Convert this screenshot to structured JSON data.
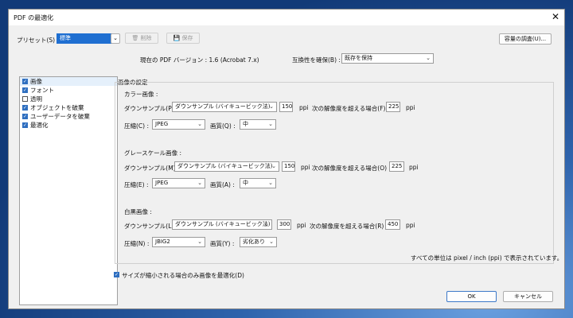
{
  "dialog": {
    "title": "PDF の最適化",
    "close_glyph": "✕"
  },
  "toolbar": {
    "preset_label": "プリセット(S) :",
    "preset_value": "標準",
    "delete_label": "削除",
    "save_label": "保存",
    "audit_label": "容量の調査(U)..."
  },
  "version": {
    "current": "現在の PDF バージョン : 1.6 (Acrobat 7.x)",
    "compat_label": "互換性を確保(B) :",
    "compat_value": "既存を保持"
  },
  "sidebar": {
    "items": [
      {
        "label": "画像",
        "checked": true
      },
      {
        "label": "フォント",
        "checked": true
      },
      {
        "label": "透明",
        "checked": false
      },
      {
        "label": "オブジェクトを破棄",
        "checked": true
      },
      {
        "label": "ユーザーデータを破棄",
        "checked": true
      },
      {
        "label": "最適化",
        "checked": true
      }
    ]
  },
  "settings": {
    "group_title": "画像の設定",
    "color": {
      "title": "カラー画像 :",
      "downsample_label": "ダウンサンプル(P) :",
      "downsample_value": "ダウンサンプル (バイキュービック法)",
      "ppi_value": "150",
      "ppi_unit": "ppi",
      "above_label": "次の解像度を超える場合(F) :",
      "above_value": "225",
      "above_unit": "ppi",
      "compress_label": "圧縮(C) :",
      "compress_value": "JPEG",
      "quality_label": "画質(Q) :",
      "quality_value": "中"
    },
    "gray": {
      "title": "グレースケール画像 :",
      "downsample_label": "ダウンサンプル(M) :",
      "downsample_value": "ダウンサンプル (バイキュービック法)",
      "ppi_value": "150",
      "ppi_unit": "ppi",
      "above_label": "次の解像度を超える場合(O) :",
      "above_value": "225",
      "above_unit": "ppi",
      "compress_label": "圧縮(E) :",
      "compress_value": "JPEG",
      "quality_label": "画質(A) :",
      "quality_value": "中"
    },
    "mono": {
      "title": "白黒画像 :",
      "downsample_label": "ダウンサンプル(L) :",
      "downsample_value": "ダウンサンプル (バイキュービック法)",
      "ppi_value": "300",
      "ppi_unit": "ppi",
      "above_label": "次の解像度を超える場合(R) :",
      "above_value": "450",
      "above_unit": "ppi",
      "compress_label": "圧縮(N) :",
      "compress_value": "JBIG2",
      "quality_label": "画質(Y) :",
      "quality_value": "劣化あり"
    },
    "units_note": "すべての単位は pixel / inch (ppi) で表示されています。",
    "optimize_if_smaller": "サイズが縮小される場合のみ画像を最適化(D)",
    "optimize_if_smaller_checked": true
  },
  "footer": {
    "ok_label": "OK",
    "cancel_label": "キャンセル"
  }
}
